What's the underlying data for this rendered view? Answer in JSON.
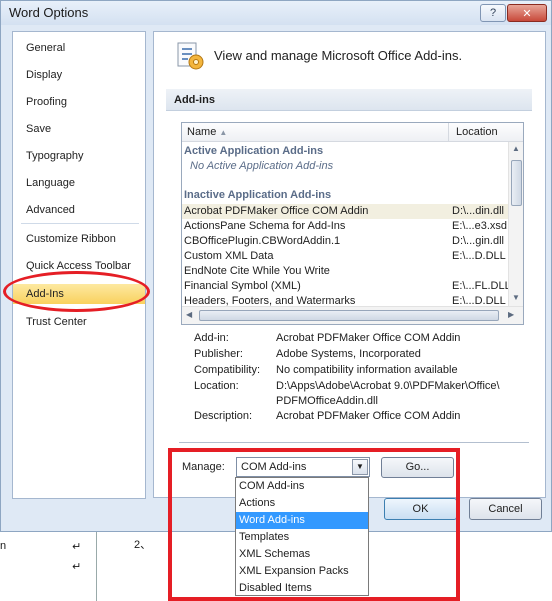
{
  "window": {
    "title": "Word Options",
    "help_glyph": "?",
    "close_glyph": "✕"
  },
  "nav": {
    "items": [
      {
        "label": "General"
      },
      {
        "label": "Display"
      },
      {
        "label": "Proofing"
      },
      {
        "label": "Save"
      },
      {
        "label": "Typography"
      },
      {
        "label": "Language"
      },
      {
        "label": "Advanced"
      },
      {
        "label": "Customize Ribbon"
      },
      {
        "label": "Quick Access Toolbar"
      },
      {
        "label": "Add-Ins",
        "selected": true
      },
      {
        "label": "Trust Center"
      }
    ]
  },
  "header": {
    "title": "View and manage Microsoft Office Add-ins.",
    "icon": "addins-gear-icon"
  },
  "addins": {
    "section_title": "Add-ins",
    "columns": {
      "name": "Name",
      "sort_indicator": "▲",
      "location": "Location"
    },
    "active_group": "Active Application Add-ins",
    "active_empty": "No Active Application Add-ins",
    "inactive_group": "Inactive Application Add-ins",
    "rows": [
      {
        "name": "Acrobat PDFMaker Office COM Addin",
        "location": "D:\\...din.dll"
      },
      {
        "name": "ActionsPane Schema for Add-Ins",
        "location": "E:\\...e3.xsd"
      },
      {
        "name": "CBOfficePlugin.CBWordAddin.1",
        "location": "D:\\...gin.dll"
      },
      {
        "name": "Custom XML Data",
        "location": "E:\\...D.DLL"
      },
      {
        "name": "EndNote Cite While You Write",
        "location": ""
      },
      {
        "name": "Financial Symbol (XML)",
        "location": "E:\\...FL.DLL"
      },
      {
        "name": "Headers, Footers, and Watermarks",
        "location": "E:\\...D.DLL"
      }
    ]
  },
  "details": {
    "addin_label": "Add-in:",
    "addin_value": "Acrobat PDFMaker Office COM Addin",
    "publisher_label": "Publisher:",
    "publisher_value": "Adobe Systems, Incorporated",
    "compat_label": "Compatibility:",
    "compat_value": "No compatibility information available",
    "location_label": "Location:",
    "location_value_1": "D:\\Apps\\Adobe\\Acrobat 9.0\\PDFMaker\\Office\\",
    "location_value_2": "PDFMOfficeAddin.dll",
    "description_label": "Description:",
    "description_value": "Acrobat PDFMaker Office COM Addin"
  },
  "manage": {
    "label": "Manage:",
    "selected": "COM Add-ins",
    "go_label": "Go...",
    "options": [
      {
        "label": "COM Add-ins"
      },
      {
        "label": "Actions"
      },
      {
        "label": "Word Add-ins",
        "highlighted": true
      },
      {
        "label": "Templates"
      },
      {
        "label": "XML Schemas"
      },
      {
        "label": "XML Expansion Packs"
      },
      {
        "label": "Disabled Items"
      }
    ]
  },
  "buttons": {
    "ok": "OK",
    "cancel": "Cancel"
  },
  "background_doc": {
    "left_text": "n",
    "marker": "↵",
    "numbered": "2、"
  },
  "colors": {
    "annotation_red": "#e51e25",
    "selection_blue": "#3399ff",
    "nav_selected": "#f9d15e"
  }
}
